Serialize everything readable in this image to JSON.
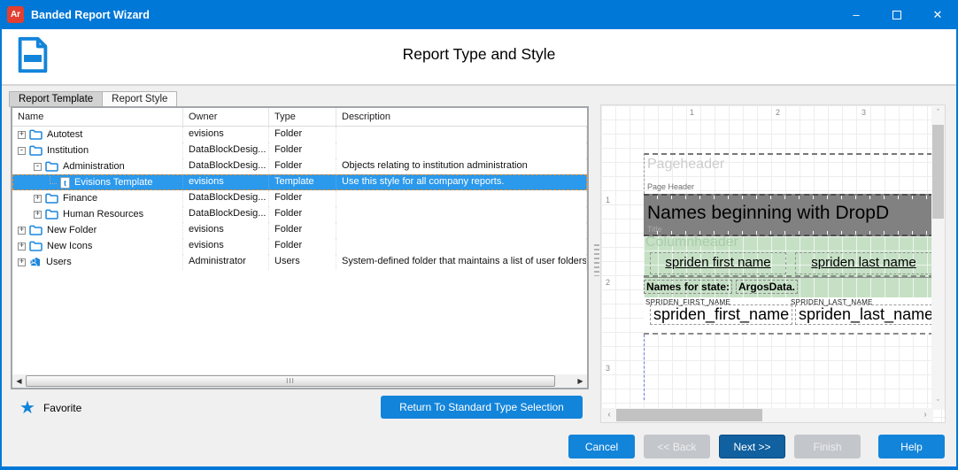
{
  "window": {
    "title": "Banded Report Wizard",
    "app_icon_text": "Ar"
  },
  "header": {
    "title": "Report Type and Style"
  },
  "tabs": [
    {
      "label": "Report Template",
      "active": true
    },
    {
      "label": "Report Style",
      "active": false
    }
  ],
  "table": {
    "columns": [
      "Name",
      "Owner",
      "Type",
      "Description"
    ],
    "rows": [
      {
        "name": "Autotest",
        "owner": "evisions",
        "type": "Folder",
        "description": "",
        "level": 0,
        "expand": "+",
        "icon": "folder",
        "selected": false
      },
      {
        "name": "Institution",
        "owner": "DataBlockDesig...",
        "type": "Folder",
        "description": "",
        "level": 0,
        "expand": "-",
        "icon": "folder",
        "selected": false
      },
      {
        "name": "Administration",
        "owner": "DataBlockDesig...",
        "type": "Folder",
        "description": "Objects relating to institution administration",
        "level": 1,
        "expand": "-",
        "icon": "folder",
        "selected": false
      },
      {
        "name": "Evisions Template",
        "owner": "evisions",
        "type": "Template",
        "description": "Use this style for all company reports.",
        "level": 2,
        "expand": "none",
        "icon": "template",
        "selected": true
      },
      {
        "name": "Finance",
        "owner": "DataBlockDesig...",
        "type": "Folder",
        "description": "",
        "level": 1,
        "expand": "+",
        "icon": "folder",
        "selected": false
      },
      {
        "name": "Human Resources",
        "owner": "DataBlockDesig...",
        "type": "Folder",
        "description": "",
        "level": 1,
        "expand": "+",
        "icon": "folder",
        "selected": false
      },
      {
        "name": "New Folder",
        "owner": "evisions",
        "type": "Folder",
        "description": "",
        "level": 0,
        "expand": "+",
        "icon": "folder",
        "selected": false
      },
      {
        "name": "New Icons",
        "owner": "evisions",
        "type": "Folder",
        "description": "",
        "level": 0,
        "expand": "+",
        "icon": "folder",
        "selected": false
      },
      {
        "name": "Users",
        "owner": "Administrator",
        "type": "Users",
        "description": "System-defined folder that maintains a list of user folders",
        "level": 0,
        "expand": "+",
        "icon": "users",
        "selected": false
      }
    ],
    "scroll_grip": "III"
  },
  "favorite": {
    "label": "Favorite"
  },
  "return_button": {
    "label": "Return To Standard Type Selection"
  },
  "preview": {
    "ruler_top": [
      "1",
      "2",
      "3"
    ],
    "ruler_left": [
      "1",
      "2",
      "3"
    ],
    "pageheader_label": "Pageheader",
    "pageheader_sublabel": "Page Header",
    "title_text": "Names beginning with DropD",
    "title_band_label": "Title",
    "columnheader_label": "Columnheader",
    "column1": "spriden first name",
    "column2": "spriden last name",
    "state_label": "Names for state:",
    "state_value": "ArgosData.",
    "field1_caption": "SPRIDEN_FIRST_NAME",
    "field1_value": "spriden_first_name",
    "field2_caption": "SPRIDEN_LAST_NAME",
    "field2_value": "spriden_last_name"
  },
  "footer_buttons": [
    {
      "label": "Cancel",
      "state": "enabled"
    },
    {
      "label": "<< Back",
      "state": "disabled"
    },
    {
      "label": "Next >>",
      "state": "default"
    },
    {
      "label": "Finish",
      "state": "disabled"
    },
    {
      "label": "Help",
      "state": "enabled"
    }
  ],
  "colors": {
    "titlebar": "#0078d7",
    "app_icon": "#e23f30",
    "accent_button": "#1284da",
    "default_button": "#11609f",
    "disabled_button": "#c3c7cb",
    "selected_row": "#2b99ec",
    "selection_focus_dash": "#e08a2e",
    "title_band": "#818181",
    "columnheader_band": "#c6e0c6"
  }
}
